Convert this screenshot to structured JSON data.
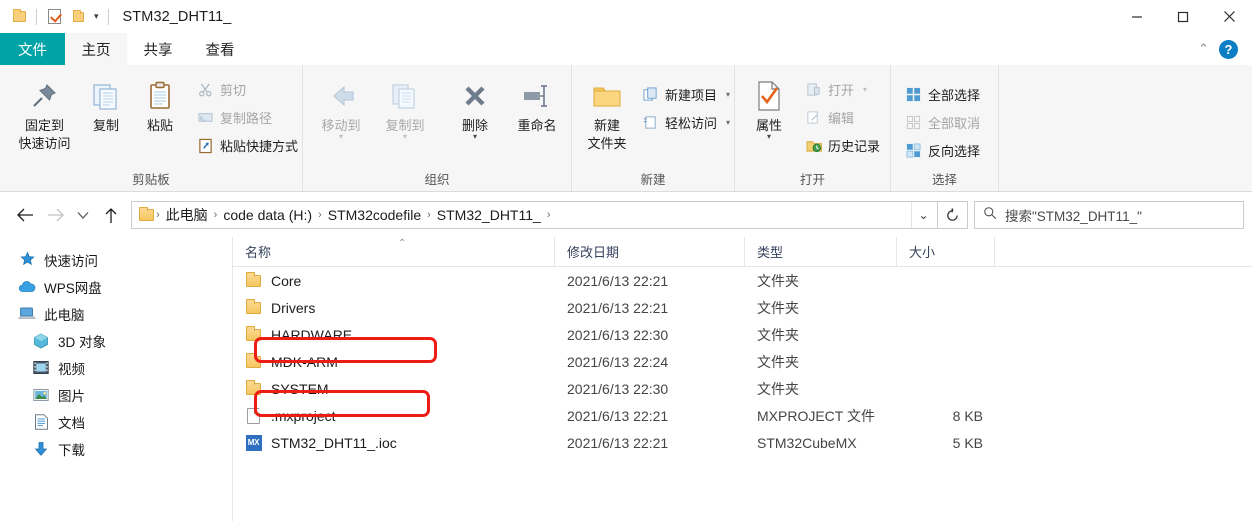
{
  "window": {
    "title": "STM32_DHT11_",
    "quick_access": {
      "folder_icon": "folder-icon",
      "properties_icon": "properties-icon",
      "new_folder_icon": "new-folder-icon",
      "customize_caret": "▾"
    },
    "controls": {
      "minimize": "minimize-icon",
      "maximize": "maximize-icon",
      "close": "close-icon"
    }
  },
  "ribbon": {
    "tabs": [
      {
        "label": "文件",
        "id": "file",
        "state": "file"
      },
      {
        "label": "主页",
        "id": "home",
        "state": "active"
      },
      {
        "label": "共享",
        "id": "share",
        "state": "normal"
      },
      {
        "label": "查看",
        "id": "view",
        "state": "normal"
      }
    ],
    "collapse_caret": "⌃",
    "help_label": "?",
    "groups": [
      {
        "label": "剪贴板",
        "big": [
          {
            "label_line1": "固定到",
            "label_line2": "快速访问",
            "icon": "pin-icon",
            "disabled": false
          },
          {
            "label_line1": "复制",
            "label_line2": "",
            "icon": "copy-icon",
            "disabled": false
          },
          {
            "label_line1": "粘贴",
            "label_line2": "",
            "icon": "paste-icon",
            "disabled": false
          }
        ],
        "small": [
          {
            "label": "剪切",
            "icon": "scissors-icon",
            "disabled": true
          },
          {
            "label": "复制路径",
            "icon": "copy-path-icon",
            "disabled": true
          },
          {
            "label": "粘贴快捷方式",
            "icon": "paste-shortcut-icon",
            "disabled": false
          }
        ]
      },
      {
        "label": "组织",
        "big": [
          {
            "label_line1": "移动到",
            "label_line2": "",
            "icon": "move-to-icon",
            "disabled": true,
            "caret": "▾"
          },
          {
            "label_line1": "复制到",
            "label_line2": "",
            "icon": "copy-to-icon",
            "disabled": true,
            "caret": "▾"
          },
          {
            "label_line1": "删除",
            "label_line2": "",
            "icon": "delete-icon",
            "disabled": false,
            "caret": "▾"
          },
          {
            "label_line1": "重命名",
            "label_line2": "",
            "icon": "rename-icon",
            "disabled": false
          }
        ],
        "small": []
      },
      {
        "label": "新建",
        "big": [
          {
            "label_line1": "新建",
            "label_line2": "文件夹",
            "icon": "new-folder-icon",
            "disabled": false
          }
        ],
        "small": [
          {
            "label": "新建项目",
            "icon": "new-item-icon",
            "disabled": false,
            "caret": "▾"
          },
          {
            "label": "轻松访问",
            "icon": "easy-access-icon",
            "disabled": false,
            "caret": "▾"
          }
        ]
      },
      {
        "label": "打开",
        "big": [
          {
            "label_line1": "属性",
            "label_line2": "",
            "icon": "properties-icon",
            "disabled": false,
            "caret": "▾"
          }
        ],
        "small": [
          {
            "label": "打开",
            "icon": "open-icon",
            "disabled": true,
            "caret": "▾"
          },
          {
            "label": "编辑",
            "icon": "edit-icon",
            "disabled": true
          },
          {
            "label": "历史记录",
            "icon": "history-icon",
            "disabled": false
          }
        ]
      },
      {
        "label": "选择",
        "big": [],
        "small": [
          {
            "label": "全部选择",
            "icon": "select-all-icon",
            "disabled": false
          },
          {
            "label": "全部取消",
            "icon": "select-none-icon",
            "disabled": true
          },
          {
            "label": "反向选择",
            "icon": "invert-selection-icon",
            "disabled": false
          }
        ]
      }
    ]
  },
  "addressbar": {
    "back_icon": "back-arrow-icon",
    "forward_icon": "forward-arrow-icon",
    "recent_icon": "recent-locations-icon",
    "up_icon": "up-arrow-icon",
    "path_icon": "folder-icon",
    "crumbs": [
      "此电脑",
      "code data (H:)",
      "STM32codefile",
      "STM32_DHT11_"
    ],
    "separator": "›",
    "dropdown_caret": "⌄",
    "refresh_icon": "refresh-icon",
    "search": {
      "icon": "search-icon",
      "placeholder": "搜索\"STM32_DHT11_\""
    }
  },
  "sidebar": {
    "items": [
      {
        "label": "快速访问",
        "icon": "star-pin-icon",
        "indent": false
      },
      {
        "label": "WPS网盘",
        "icon": "cloud-icon",
        "indent": false
      },
      {
        "label": "此电脑",
        "icon": "this-pc-icon",
        "indent": false
      },
      {
        "label": "3D 对象",
        "icon": "3d-objects-icon",
        "indent": true
      },
      {
        "label": "视频",
        "icon": "videos-icon",
        "indent": true
      },
      {
        "label": "图片",
        "icon": "pictures-icon",
        "indent": true
      },
      {
        "label": "文档",
        "icon": "documents-icon",
        "indent": true
      },
      {
        "label": "下载",
        "icon": "downloads-icon",
        "indent": true
      }
    ]
  },
  "filelist": {
    "columns": [
      "名称",
      "修改日期",
      "类型",
      "大小"
    ],
    "sort_indicator": "⌃",
    "rows": [
      {
        "name": "Core",
        "date": "2021/6/13 22:21",
        "type": "文件夹",
        "size": "",
        "icon": "folder-icon",
        "highlighted": false
      },
      {
        "name": "Drivers",
        "date": "2021/6/13 22:21",
        "type": "文件夹",
        "size": "",
        "icon": "folder-icon",
        "highlighted": false
      },
      {
        "name": "HARDWARE",
        "date": "2021/6/13 22:30",
        "type": "文件夹",
        "size": "",
        "icon": "folder-icon",
        "highlighted": true
      },
      {
        "name": "MDK-ARM",
        "date": "2021/6/13 22:24",
        "type": "文件夹",
        "size": "",
        "icon": "folder-icon",
        "highlighted": false
      },
      {
        "name": "SYSTEM",
        "date": "2021/6/13 22:30",
        "type": "文件夹",
        "size": "",
        "icon": "folder-icon",
        "highlighted": true
      },
      {
        "name": ".mxproject",
        "date": "2021/6/13 22:21",
        "type": "MXPROJECT 文件",
        "size": "8 KB",
        "icon": "generic-file-icon",
        "highlighted": false
      },
      {
        "name": "STM32_DHT11_.ioc",
        "date": "2021/6/13 22:21",
        "type": "STM32CubeMX",
        "size": "5 KB",
        "icon": "cubemx-file-icon",
        "highlighted": false
      }
    ]
  },
  "colors": {
    "file_tab": "#00a4a6",
    "highlight": "#ef1c15",
    "folder": "#f5c65f",
    "accent_blue": "#0b7ec4"
  }
}
